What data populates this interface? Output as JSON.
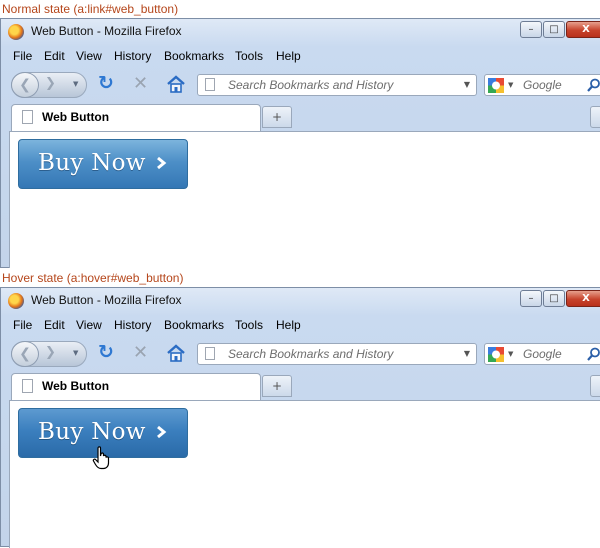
{
  "states": [
    {
      "caption": "Normal state (a:link#web_button)",
      "window_title": "Web Button - Mozilla Firefox",
      "menu": [
        "File",
        "Edit",
        "View",
        "History",
        "Bookmarks",
        "Tools",
        "Help"
      ],
      "url_placeholder": "Search Bookmarks and History",
      "search_placeholder": "Google",
      "tab_label": "Web Button",
      "new_tab_label": "+",
      "button_label": "Buy Now",
      "button_state": "normal"
    },
    {
      "caption": "Hover state (a:hover#web_button)",
      "window_title": "Web Button - Mozilla Firefox",
      "menu": [
        "File",
        "Edit",
        "View",
        "History",
        "Bookmarks",
        "Tools",
        "Help"
      ],
      "url_placeholder": "Search Bookmarks and History",
      "search_placeholder": "Google",
      "tab_label": "Web Button",
      "new_tab_label": "+",
      "button_label": "Buy Now",
      "button_state": "hover"
    }
  ],
  "colors": {
    "caption": "#b5461b",
    "button_normal": "#4d8fc7",
    "button_hover": "#3b7fbe",
    "close_button": "#c7432c"
  },
  "icons": [
    "firefox-logo",
    "back-arrow-icon",
    "forward-arrow-icon",
    "reload-icon",
    "stop-icon",
    "home-icon",
    "page-icon",
    "google-icon",
    "search-icon",
    "chevron-right-icon",
    "hand-cursor-icon"
  ]
}
